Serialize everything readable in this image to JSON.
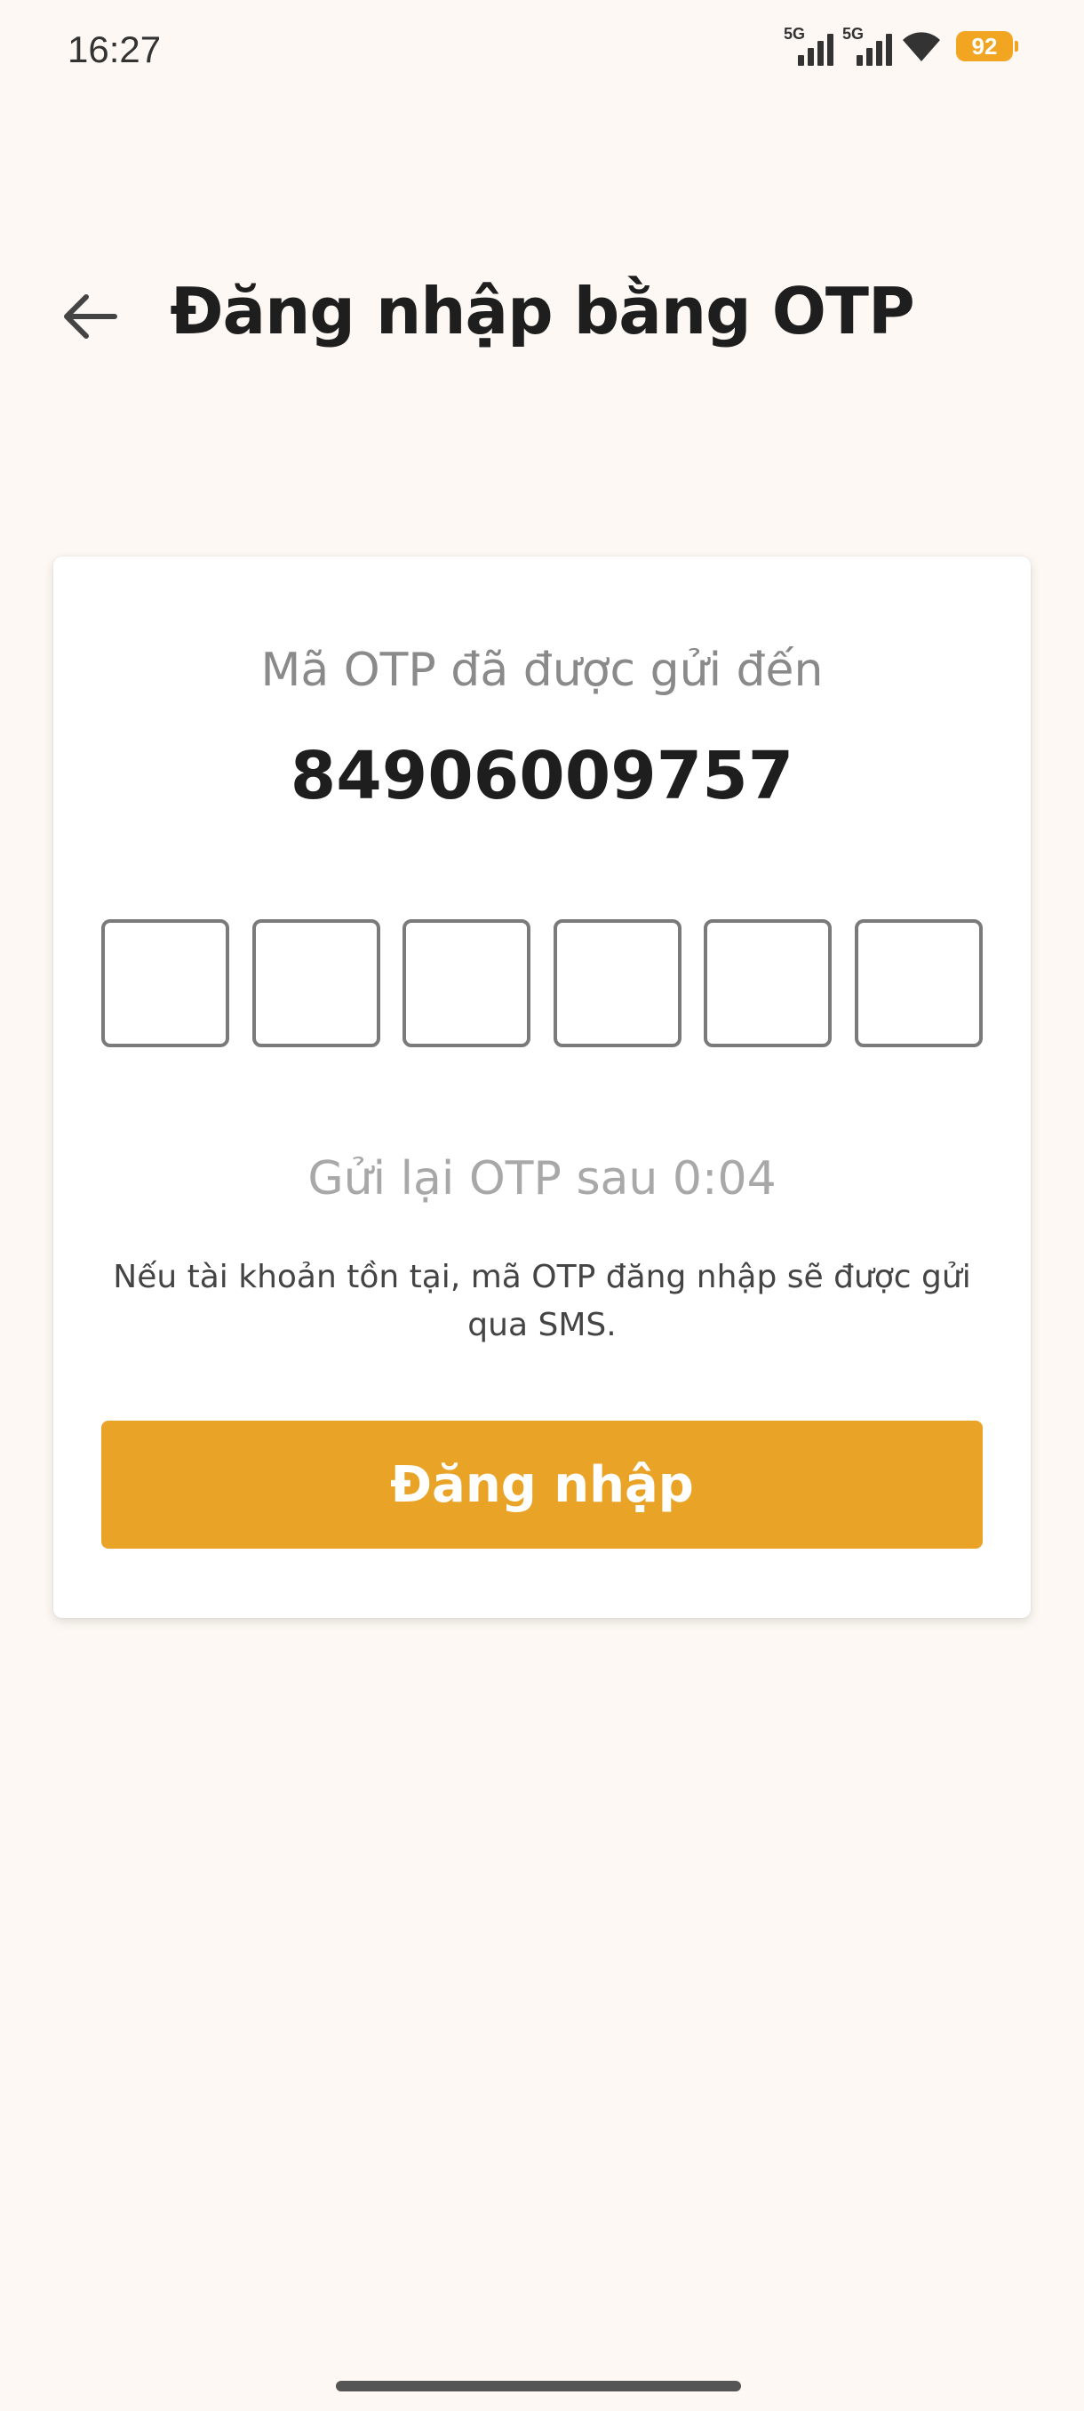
{
  "status_bar": {
    "time": "16:27",
    "signal1_label": "5G",
    "signal2_label": "5G",
    "battery_level": "92"
  },
  "header": {
    "title": "Đăng nhập bằng OTP",
    "back_icon": "arrow-left-icon"
  },
  "card": {
    "sent_label": "Mã OTP đã được gửi đến",
    "phone_number": "84906009757",
    "otp_digits": [
      "",
      "",
      "",
      "",
      "",
      ""
    ],
    "resend_text": "Gửi lại OTP sau 0:04",
    "info_text": "Nếu tài khoản tồn tại, mã OTP đăng nhập sẽ được gửi qua SMS.",
    "login_label": "Đăng nhập"
  },
  "colors": {
    "accent": "#E9A327",
    "background": "#FDF8F3",
    "battery": "#F2A521"
  }
}
